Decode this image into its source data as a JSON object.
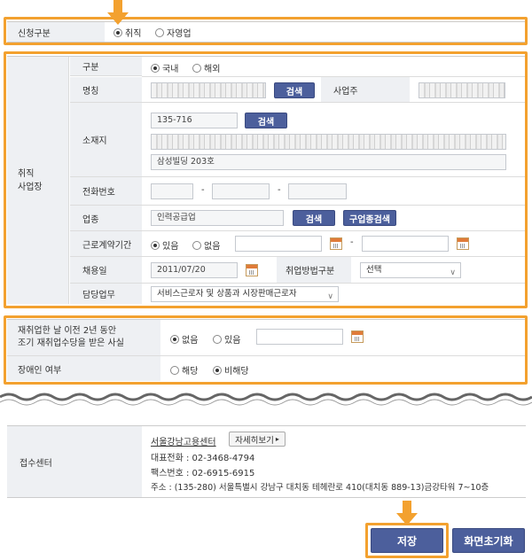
{
  "application": {
    "label": "신청구분",
    "options": [
      "취직",
      "자영업"
    ],
    "selected": "취직"
  },
  "workplace": {
    "group_label": "취직\n사업장",
    "type": {
      "label": "구분",
      "options": [
        "국내",
        "해외"
      ],
      "selected": "국내"
    },
    "name": {
      "label": "명칭",
      "search_button": "검색",
      "owner_label": "사업주"
    },
    "address": {
      "label": "소재지",
      "postal_code": "135-716",
      "search_button": "검색",
      "detail": "삼성빌딩 203호"
    },
    "phone": {
      "label": "전화번호",
      "sep": "-"
    },
    "industry": {
      "label": "업종",
      "value": "인력공급업",
      "search_button": "검색",
      "job_search_button": "구업종검색"
    },
    "contract": {
      "label": "근로계약기간",
      "options": [
        "있음",
        "없음"
      ],
      "selected": "있음",
      "sep": "-"
    },
    "hire_date": {
      "label": "채용일",
      "value": "2011/07/20",
      "method_label": "취업방법구분",
      "method_value": "선택"
    },
    "duty": {
      "label": "담당업무",
      "value": "서비스근로자 및 상품과 시장판매근로자"
    }
  },
  "extra": {
    "reemployment_label_1": "재취업한 날 이전 2년 동안",
    "reemployment_label_2": "조기 재취업수당을 받은 사실",
    "reemployment_options": [
      "없음",
      "있음"
    ],
    "reemployment_selected": "없음",
    "disability_label": "장애인 여부",
    "disability_options": [
      "해당",
      "비해당"
    ],
    "disability_selected": "비해당"
  },
  "center": {
    "label": "접수센터",
    "name": "서울강남고용센터",
    "detail_button": "자세히보기",
    "phone": "대표전화 : 02-3468-4794",
    "fax": "팩스번호 : 02-6915-6915",
    "address": "주소 : (135-280) 서울특별시 강남구 대치동 테헤란로 410(대치동 889-13)금강타워 7~10층"
  },
  "actions": {
    "save": "저장",
    "reset": "화면초기화"
  },
  "colors": {
    "highlight": "#f3a12f",
    "button": "#4c5f9c",
    "label_bg": "#eef0f3"
  }
}
